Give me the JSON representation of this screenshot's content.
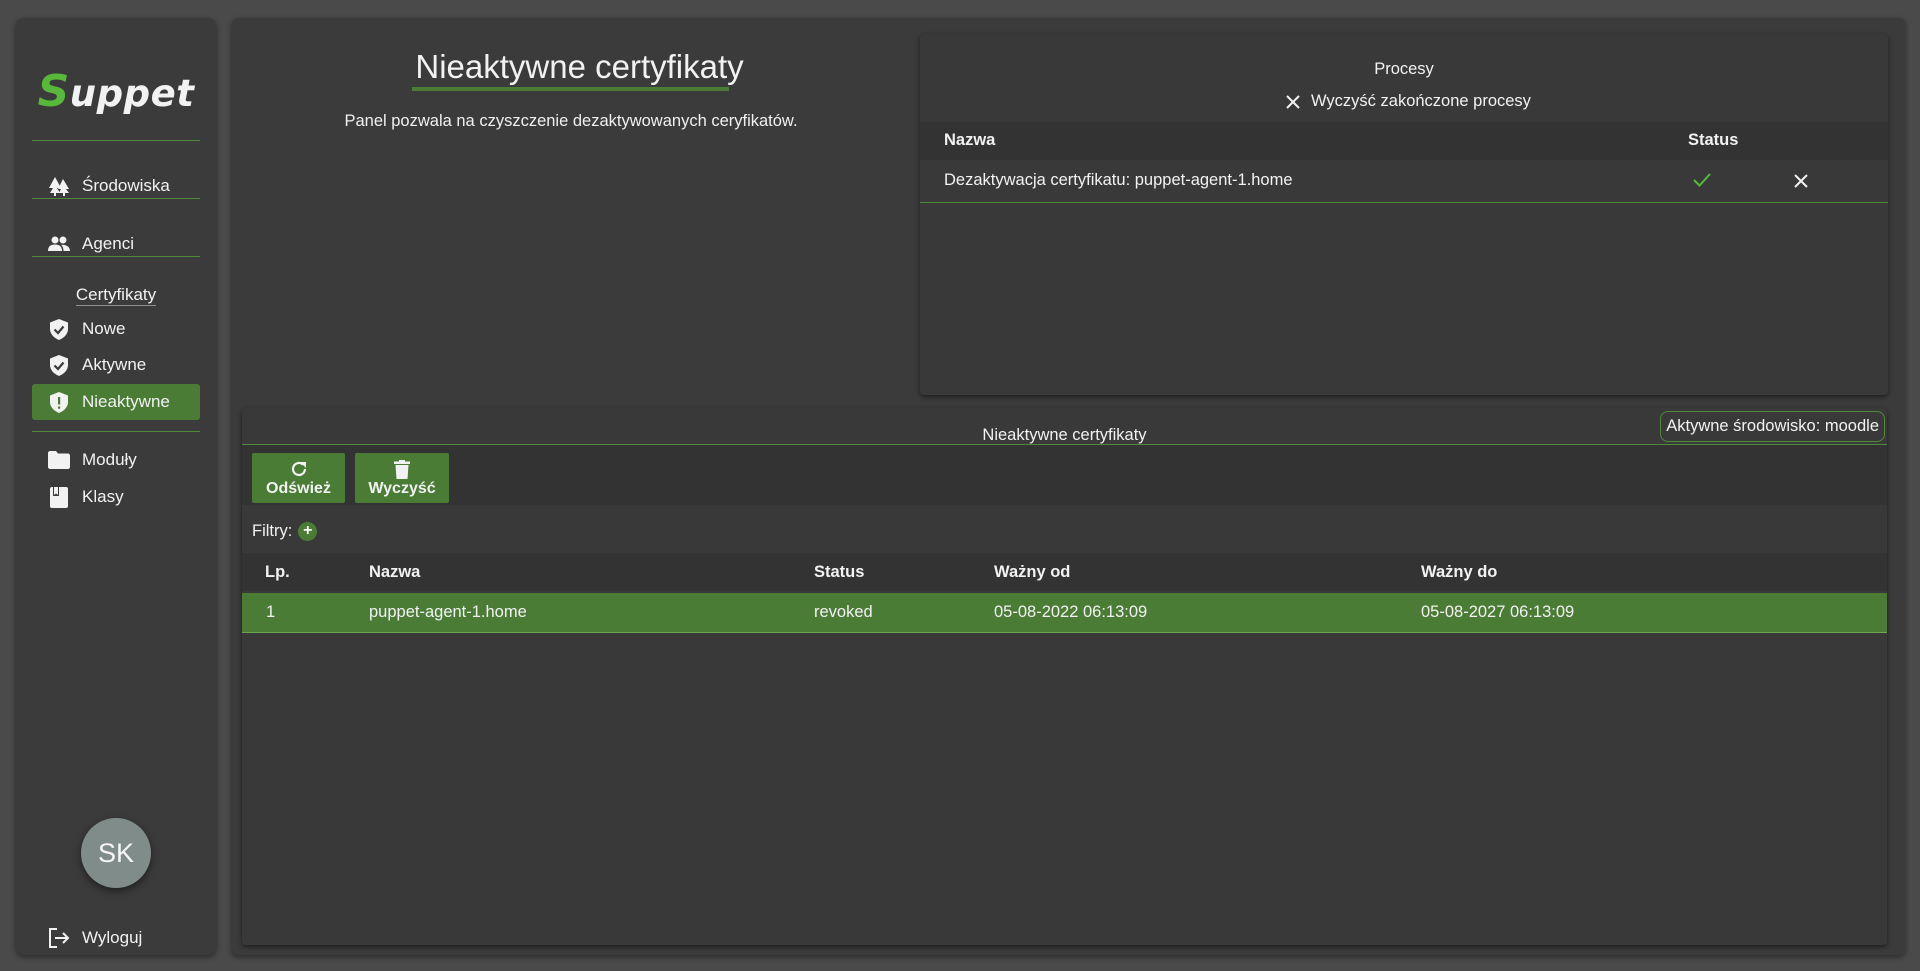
{
  "sidebar": {
    "logo_first": "S",
    "logo_rest": "uppet",
    "nav": {
      "srodowiska": "Środowiska",
      "agenci": "Agenci",
      "cert_section": "Certyfikaty",
      "nowe": "Nowe",
      "aktywne": "Aktywne",
      "nieaktywne": "Nieaktywne",
      "moduly": "Moduły",
      "klasy": "Klasy"
    },
    "avatar_initials": "SK",
    "logout": "Wyloguj"
  },
  "header": {
    "title": "Nieaktywne certyfikaty",
    "description": "Panel pozwala na czyszczenie dezaktywowanych ceryfikatów."
  },
  "processes": {
    "title": "Procesy",
    "clear_label": "Wyczyść zakończone procesy",
    "columns": {
      "name": "Nazwa",
      "status": "Status"
    },
    "rows": [
      {
        "name": "Dezaktywacja certyfikatu: puppet-agent-1.home",
        "status": "done"
      }
    ]
  },
  "certs": {
    "title": "Nieaktywne certyfikaty",
    "active_env": "Aktywne środowisko: moodle",
    "refresh_label": "Odśwież",
    "clear_label": "Wyczyść",
    "filters_label": "Filtry:",
    "columns": {
      "lp": "Lp.",
      "name": "Nazwa",
      "status": "Status",
      "valid_from": "Ważny od",
      "valid_to": "Ważny do"
    },
    "rows": [
      {
        "lp": "1",
        "name": "puppet-agent-1.home",
        "status": "revoked",
        "valid_from": "05-08-2022 06:13:09",
        "valid_to": "05-08-2027 06:13:09"
      }
    ]
  },
  "colors": {
    "accent": "#4a7c36",
    "logo_accent": "#57b83a",
    "panel": "#3b3b3b",
    "background": "#4a4a4a"
  }
}
